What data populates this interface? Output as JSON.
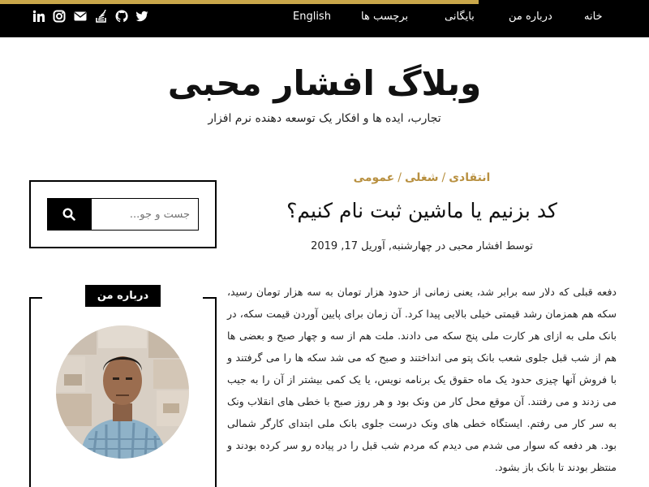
{
  "nav": {
    "home": "خانه",
    "about": "درباره من",
    "archive": "بایگانی",
    "tags": "برچسب ها",
    "english": "English"
  },
  "social_icons": [
    "twitter-icon",
    "github-icon",
    "stackoverflow-icon",
    "email-icon",
    "instagram-icon",
    "linkedin-icon"
  ],
  "header": {
    "title": "وبلاگ افشار محبی",
    "tagline": "تجارب، ایده ها و افکار یک توسعه دهنده نرم افزار"
  },
  "sidebar": {
    "search_placeholder": "جست و جو...",
    "about_label": "درباره من"
  },
  "post": {
    "categories": [
      "انتقادی",
      "شغلی",
      "عمومی"
    ],
    "title": "کد بزنیم یا ماشین ثبت نام کنیم؟",
    "meta": "توسط افشار محبی در چهارشنبه, آوریل 17, 2019",
    "body": "دفعه قبلی که دلار سه برابر شد، یعنی زمانی از حدود هزار تومان به سه هزار تومان رسید، سکه هم همزمان رشد قیمتی خیلی بالایی پیدا کرد. آن زمان برای پایین آوردن قیمت سکه، در بانک ملی به ازای هر کارت ملی پنج سکه می دادند. ملت هم از سه و چهار صبح و بعضی ها هم از شب قبل جلوی شعب بانک پتو می انداختند و صبح که می شد سکه ها را می گرفتند و با فروش آنها چیزی حدود یک ماه حقوق یک برنامه نویس، یا یک کمی بیشتر از آن را به جیب می زدند و می رفتند. آن موقع محل کار من ونک بود و هر روز صبح با خطی های انقلاب ونک به سر کار می رفتم. ایستگاه خطی های ونک درست جلوی بانک ملی ابتدای کارگر شمالی بود. هر دفعه که سوار می شدم می دیدم که مردم شب قبل را در پیاده رو سر کرده بودند و منتظر بودند تا بانک باز بشود."
  },
  "colors": {
    "topbar": "#000000",
    "accent_gold": "#c9a74a",
    "category_gold": "#b89040"
  }
}
